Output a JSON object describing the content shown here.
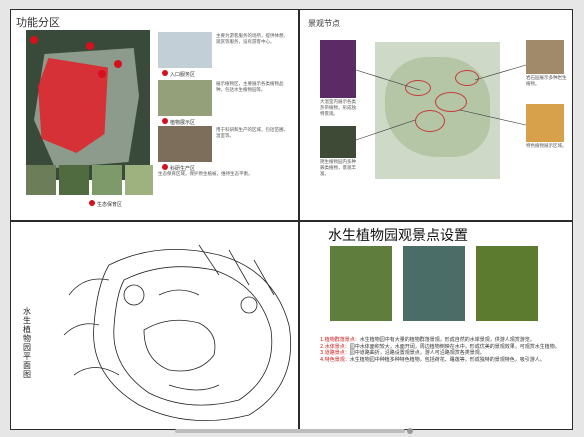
{
  "panel1": {
    "title": "功能分区",
    "captions": [
      "入口服务区",
      "植物展示区",
      "科研生产区",
      "生态保育区"
    ],
    "texts": [
      "主要为游客服务的场所，提供休憩、观赏等服务，设有游客中心。",
      "展示植物区，主要展示各类植物品种，包括水生植物园等。",
      "用于科研和生产的区域，包括苗圃、温室等。",
      "生态保育区域，保护原生植被，维持生态平衡。"
    ]
  },
  "panel2": {
    "title": "景观节点",
    "captions": [
      "大温室内展示各类热带植物，形成独特景观。",
      "阴生植物园内多种蕨类植物，景观丰富。",
      "岩石园展示多种岩生植物。",
      "特色植物展示区域。"
    ]
  },
  "panel3": {
    "vertical_text": "水生植物园平面图"
  },
  "panel4": {
    "title": "水生植物园观景点设置",
    "items": [
      {
        "label": "1.植物群落景点：",
        "text": "水生植物园中有大量的植物群落景观，形成自然的水岸景观，供游人观赏游览。"
      },
      {
        "label": "2.水体景点：",
        "text": "园中水体面积较大，水面开阔，周边植物倒映在水中，形成优美的景观效果，可观赏水生植物。"
      },
      {
        "label": "3.道路景点：",
        "text": "园中道路曲折，沿路设置观景点，游人可沿路观赏各类景观。"
      },
      {
        "label": "4.特色景观：",
        "text": "水生植物园中种植多种特色植物，包括荷花、睡莲等，形成独特的景观特色，吸引游人。"
      }
    ]
  }
}
